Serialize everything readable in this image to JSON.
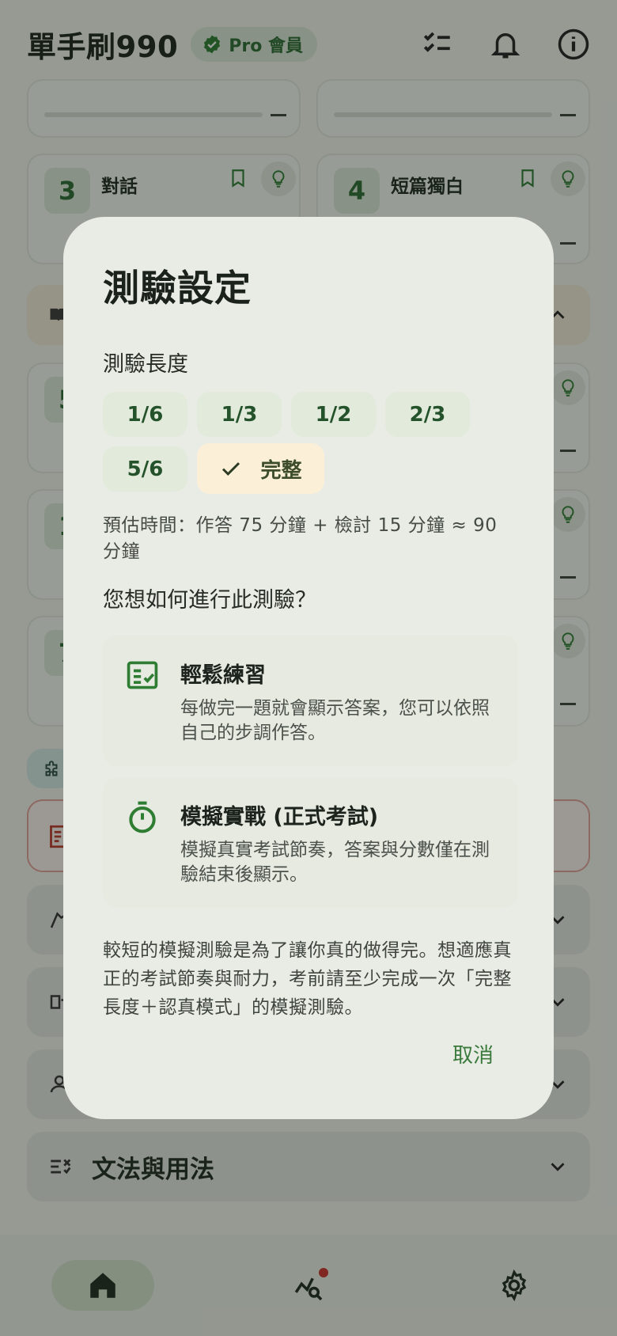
{
  "app": {
    "title": "單手刷990",
    "badge": "Pro 會員"
  },
  "background": {
    "cards": [
      {
        "number": "3",
        "title": "對話"
      },
      {
        "number": "4",
        "title": "短篇獨白"
      },
      {
        "number": "5",
        "title": ""
      },
      {
        "number": "1",
        "title": ""
      },
      {
        "number": "7",
        "title": ""
      }
    ],
    "dash": "—",
    "bottom_section": "文法與用法"
  },
  "dialog": {
    "title": "測驗設定",
    "length_label": "測驗長度",
    "length_options": [
      "1/6",
      "1/3",
      "1/2",
      "2/3",
      "5/6"
    ],
    "selected_option": "完整",
    "estimate": "預估時間：作答 75 分鐘 + 檢討 15 分鐘 ≈ 90 分鐘",
    "question": "您想如何進行此測驗？",
    "modes": [
      {
        "title": "輕鬆練習",
        "desc": "每做完一題就會顯示答案，您可以依照自己的步調作答。",
        "icon": "checklist-icon"
      },
      {
        "title": "模擬實戰 (正式考試)",
        "desc": "模擬真實考試節奏，答案與分數僅在測驗結束後顯示。",
        "icon": "timer-icon"
      }
    ],
    "note": "較短的模擬測驗是為了讓你真的做得完。想適應真正的考試節奏與耐力，考前請至少完成一次「完整長度＋認真模式」的模擬測驗。",
    "cancel": "取消"
  },
  "colors": {
    "accent": "#2e7d32",
    "selected_chip": "#fbefd8",
    "dialog_bg": "#e9ece4"
  }
}
